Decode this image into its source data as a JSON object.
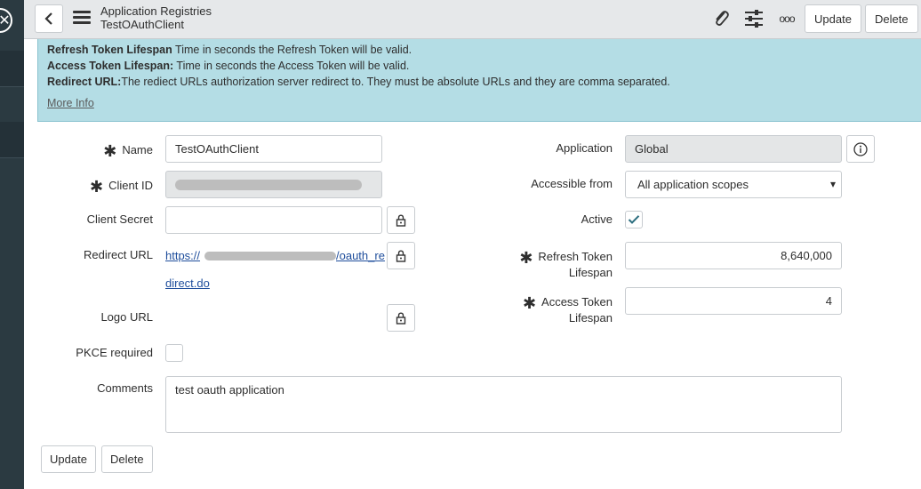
{
  "header": {
    "title": "Application Registries",
    "subtitle": "TestOAuthClient",
    "update_label": "Update",
    "delete_label": "Delete",
    "more_glyph": "ooo"
  },
  "info": {
    "lines": [
      {
        "term": "Refresh Token Lifespan",
        "desc": " Time in seconds the Refresh Token will be valid."
      },
      {
        "term": "Access Token Lifespan:",
        "desc": " Time in seconds the Access Token will be valid."
      },
      {
        "term": "Redirect URL:",
        "desc": "The rediect URLs authorization server redirect to. They must be absolute URLs and they are comma separated."
      }
    ],
    "more_info": "More Info"
  },
  "form": {
    "name": {
      "label": "Name",
      "value": "TestOAuthClient",
      "required": true
    },
    "client_id": {
      "label": "Client ID",
      "value": "",
      "required": true
    },
    "client_secret": {
      "label": "Client Secret",
      "value": ""
    },
    "redirect_url": {
      "label": "Redirect URL",
      "line1_start": "https://",
      "line1_end": "/oauth_re",
      "line2": "direct.do"
    },
    "logo_url": {
      "label": "Logo URL"
    },
    "pkce": {
      "label": "PKCE required",
      "checked": false
    },
    "comments": {
      "label": "Comments",
      "value": "test oauth application"
    },
    "application": {
      "label": "Application",
      "value": "Global"
    },
    "accessible_from": {
      "label": "Accessible from",
      "value": "All application scopes"
    },
    "active": {
      "label": "Active",
      "checked": true
    },
    "refresh_token": {
      "label_line1": "Refresh Token",
      "label_line2": "Lifespan",
      "value": "8,640,000",
      "required": true
    },
    "access_token": {
      "label_line1": "Access Token",
      "label_line2": "Lifespan",
      "value": "4",
      "required": true
    }
  },
  "footer": {
    "update_label": "Update",
    "delete_label": "Delete"
  },
  "icons": {
    "required": "✱",
    "dropdown": "▾"
  }
}
